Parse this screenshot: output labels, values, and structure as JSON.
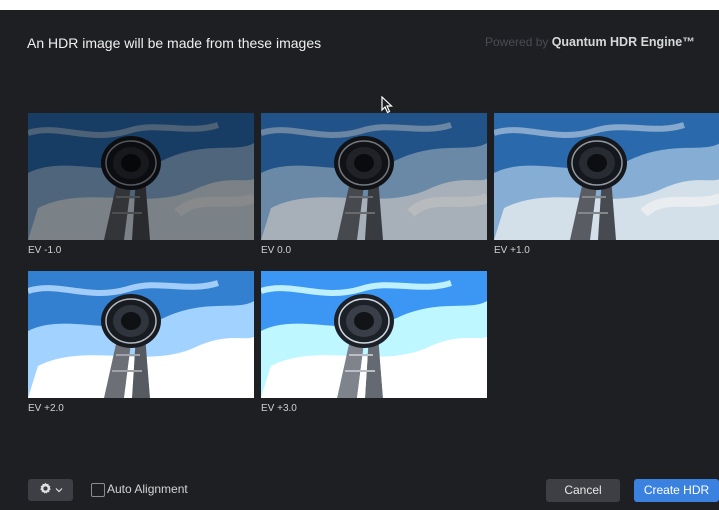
{
  "header": {
    "title": "An HDR image will be made from these images",
    "powered_prefix": "Powered by ",
    "engine_name": "Quantum HDR Engine™"
  },
  "images": [
    {
      "ev_label": "EV -1.0",
      "brightness": 0.55
    },
    {
      "ev_label": "EV 0.0",
      "brightness": 0.75
    },
    {
      "ev_label": "EV +1.0",
      "brightness": 0.95
    },
    {
      "ev_label": "EV +2.0",
      "brightness": 1.15
    },
    {
      "ev_label": "EV +3.0",
      "brightness": 1.35
    }
  ],
  "footer": {
    "auto_alignment_label": "Auto Alignment",
    "auto_alignment_checked": false,
    "cancel_label": "Cancel",
    "create_label": "Create HDR"
  },
  "colors": {
    "background": "#1e1f23",
    "button": "#3d3f45",
    "accent": "#3b82e0"
  },
  "icons": {
    "settings": "gear-icon",
    "dropdown": "chevron-down-icon",
    "cursor": "mouse-cursor-icon"
  }
}
